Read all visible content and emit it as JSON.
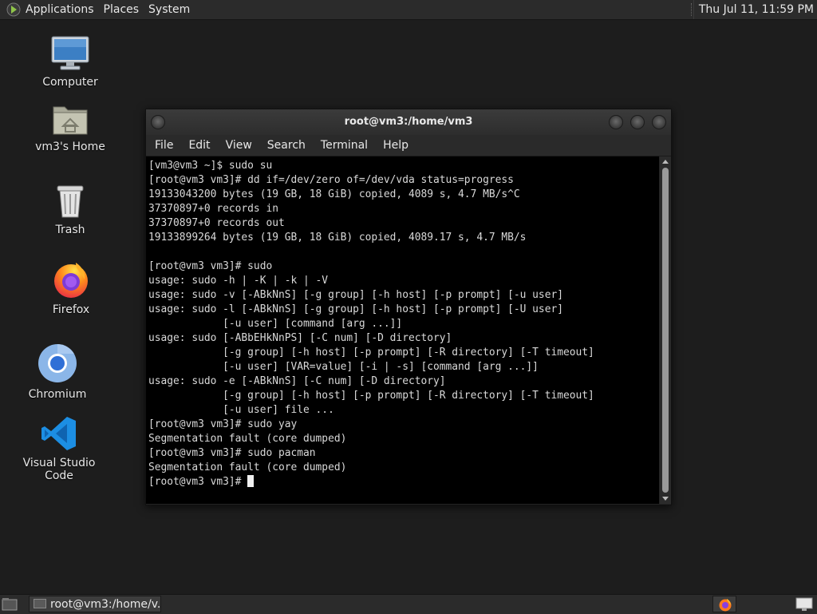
{
  "top_panel": {
    "menu_applications": "Applications",
    "menu_places": "Places",
    "menu_system": "System",
    "clock": "Thu Jul 11, 11:59 PM"
  },
  "desktop_icons": [
    {
      "label": "Computer",
      "icon": "computer-icon"
    },
    {
      "label": "vm3's Home",
      "icon": "home-folder-icon"
    },
    {
      "label": "Trash",
      "icon": "trash-icon"
    },
    {
      "label": "Firefox",
      "icon": "firefox-icon"
    },
    {
      "label": "Chromium",
      "icon": "chromium-icon"
    },
    {
      "label": "Visual Studio Code",
      "icon": "vscode-icon"
    }
  ],
  "terminal": {
    "title": "root@vm3:/home/vm3",
    "menu": [
      "File",
      "Edit",
      "View",
      "Search",
      "Terminal",
      "Help"
    ],
    "lines": [
      "[vm3@vm3 ~]$ sudo su",
      "[root@vm3 vm3]# dd if=/dev/zero of=/dev/vda status=progress",
      "19133043200 bytes (19 GB, 18 GiB) copied, 4089 s, 4.7 MB/s^C",
      "37370897+0 records in",
      "37370897+0 records out",
      "19133899264 bytes (19 GB, 18 GiB) copied, 4089.17 s, 4.7 MB/s",
      "",
      "[root@vm3 vm3]# sudo",
      "usage: sudo -h | -K | -k | -V",
      "usage: sudo -v [-ABkNnS] [-g group] [-h host] [-p prompt] [-u user]",
      "usage: sudo -l [-ABkNnS] [-g group] [-h host] [-p prompt] [-U user]",
      "            [-u user] [command [arg ...]]",
      "usage: sudo [-ABbEHkNnPS] [-C num] [-D directory]",
      "            [-g group] [-h host] [-p prompt] [-R directory] [-T timeout]",
      "            [-u user] [VAR=value] [-i | -s] [command [arg ...]]",
      "usage: sudo -e [-ABkNnS] [-C num] [-D directory]",
      "            [-g group] [-h host] [-p prompt] [-R directory] [-T timeout]",
      "            [-u user] file ...",
      "[root@vm3 vm3]# sudo yay",
      "Segmentation fault (core dumped)",
      "[root@vm3 vm3]# sudo pacman",
      "Segmentation fault (core dumped)"
    ],
    "prompt": "[root@vm3 vm3]# "
  },
  "bottom_panel": {
    "task_label": "root@vm3:/home/v..."
  },
  "colors": {
    "desktop_bg": "#1d1d1d",
    "panel_bg": "#2b2b2b",
    "terminal_bg": "#000000",
    "terminal_fg": "#d9d9d9"
  }
}
